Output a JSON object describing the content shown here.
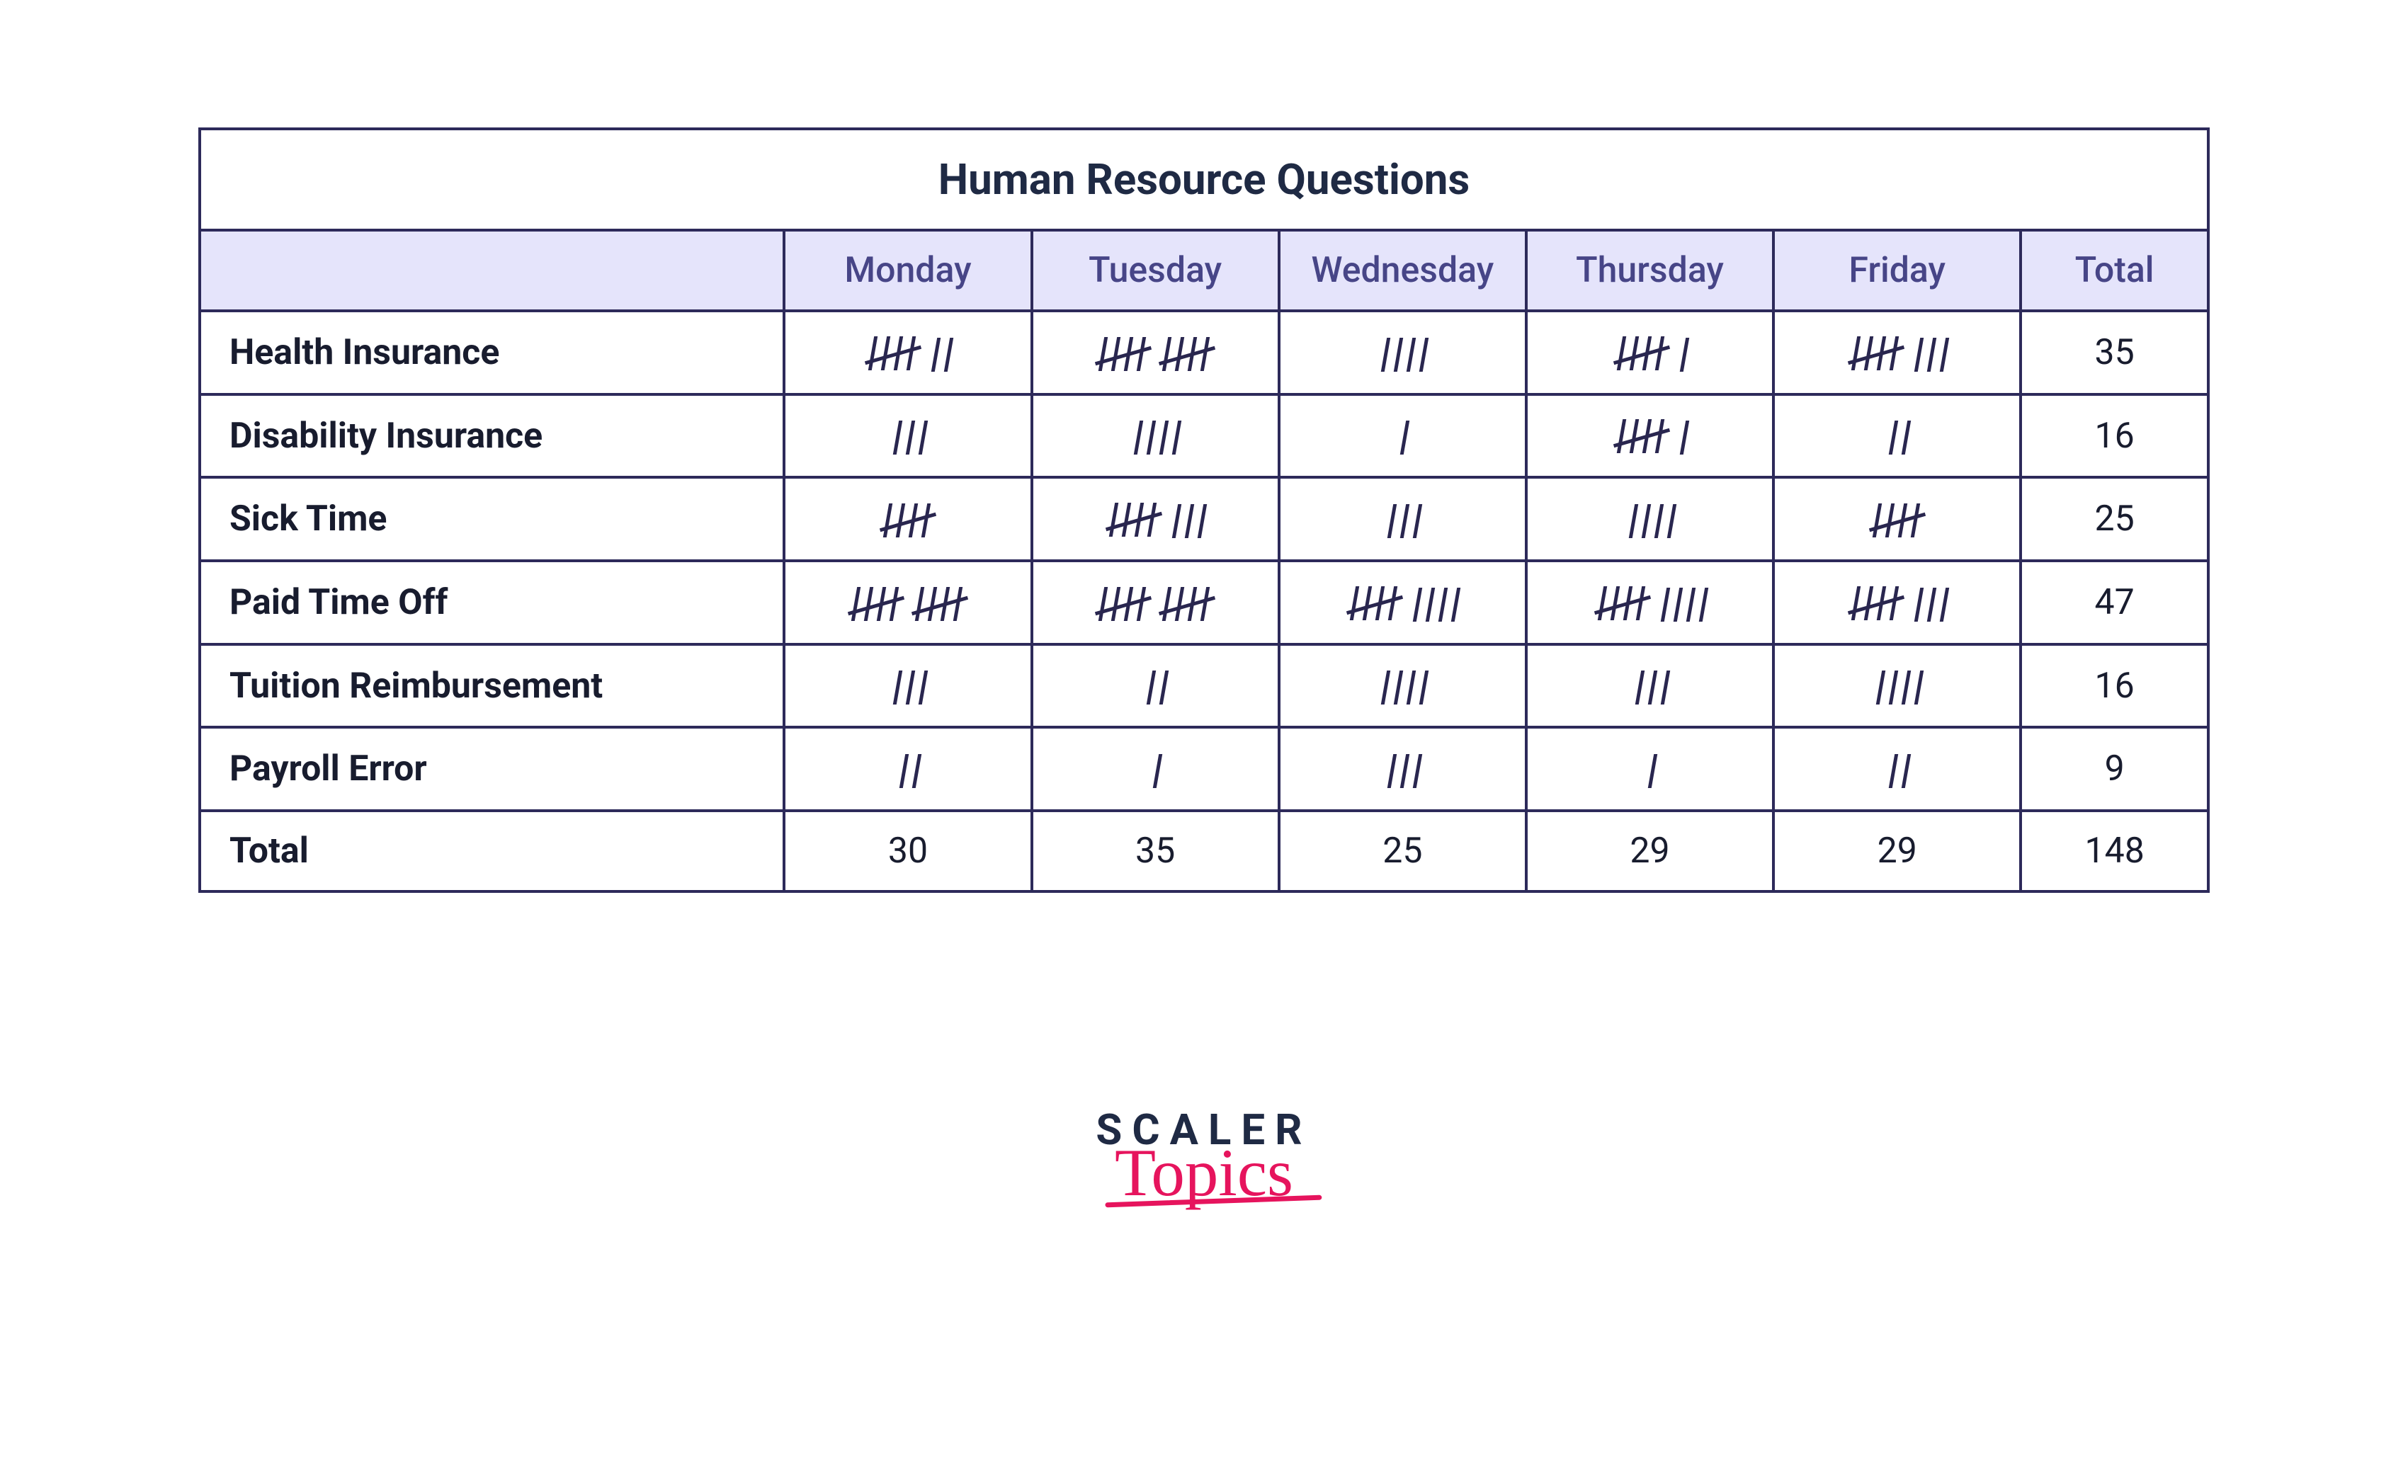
{
  "chart_data": {
    "type": "table",
    "title": "Human Resource Questions",
    "columns": [
      "Monday",
      "Tuesday",
      "Wednesday",
      "Thursday",
      "Friday",
      "Total"
    ],
    "rows": [
      {
        "label": "Health Insurance",
        "values": [
          7,
          10,
          4,
          6,
          8
        ],
        "total": 35
      },
      {
        "label": "Disability Insurance",
        "values": [
          3,
          4,
          1,
          6,
          2
        ],
        "total": 16
      },
      {
        "label": "Sick Time",
        "values": [
          5,
          8,
          3,
          4,
          5
        ],
        "total": 25
      },
      {
        "label": "Paid Time Off",
        "values": [
          10,
          10,
          9,
          9,
          8
        ],
        "total": 47
      },
      {
        "label": "Tuition Reimbursement",
        "values": [
          3,
          2,
          4,
          3,
          4
        ],
        "total": 16
      },
      {
        "label": "Payroll Error",
        "values": [
          2,
          1,
          3,
          1,
          2
        ],
        "total": 9
      }
    ],
    "column_totals": [
      30,
      35,
      25,
      29,
      29,
      148
    ],
    "total_label": "Total"
  },
  "logo": {
    "line1": "SCALER",
    "line2": "Topics"
  }
}
